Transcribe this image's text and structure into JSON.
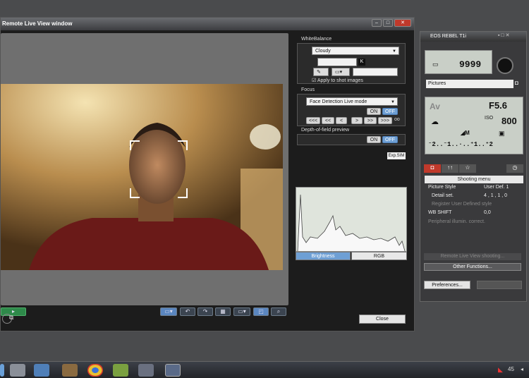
{
  "window": {
    "title": "Remote Live View window",
    "close_label": "Close"
  },
  "white_balance": {
    "section": "WhiteBalance",
    "mode": "Cloudy",
    "k_label": "K",
    "apply_label": "Apply to shot images"
  },
  "focus": {
    "section": "Focus",
    "mode": "Face Detection Live mode",
    "on": "ON",
    "off": "OFF",
    "nav": [
      "<<<",
      "<<",
      "<",
      ">",
      ">>",
      ">>>",
      "oo"
    ]
  },
  "dof": {
    "section": "Depth-of-field preview",
    "on": "ON",
    "off": "OFF"
  },
  "expsim": "Exp.SIM",
  "histogram": {
    "tab_brightness": "Brightness",
    "tab_rgb": "RGB"
  },
  "camera": {
    "title": "EOS REBEL T1i",
    "shots": "9999",
    "folder": "Pictures",
    "mode": "Av",
    "aperture": "F5.6",
    "iso": "800",
    "exposure_scale": "⁻2..⁻1..·..⁺1..⁺2",
    "shooting_menu": "Shooting menu",
    "menu": [
      {
        "label": "Picture Style",
        "value": "User Def. 1",
        "dim": false
      },
      {
        "label": "Detail set.",
        "value": "4 , 1 , 1 , 0",
        "dim": false
      },
      {
        "label": "Register User Defined style",
        "value": "",
        "dim": true
      },
      {
        "label": "WB SHIFT",
        "value": "0,0",
        "dim": false
      },
      {
        "label": "Peripheral illumin. correct.",
        "value": "",
        "dim": true
      }
    ],
    "remote_shooting": "Remote Live View shooting...",
    "other_functions": "Other Functions...",
    "preferences": "Preferences..."
  },
  "taskbar": {
    "time": "45"
  }
}
